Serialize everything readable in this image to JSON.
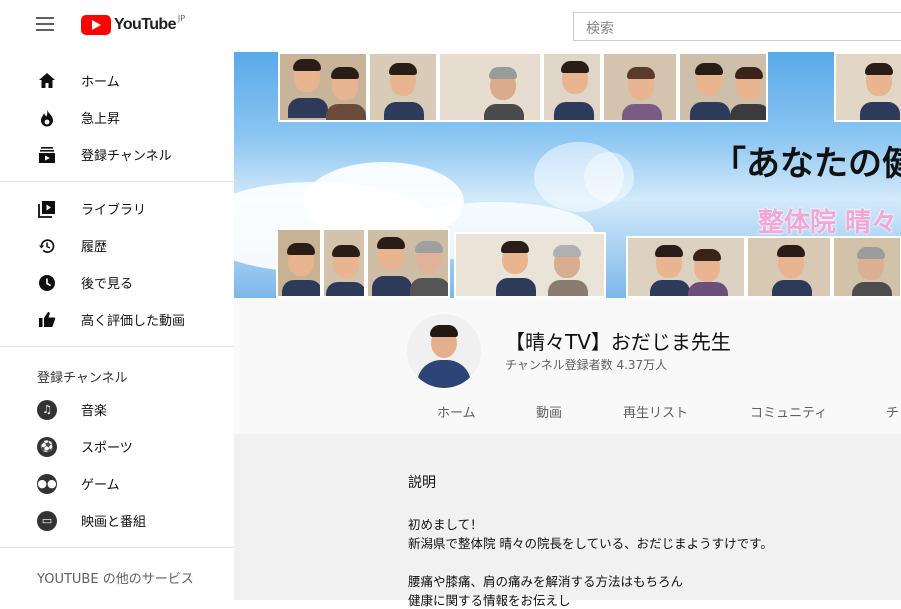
{
  "topbar": {
    "logo_text": "YouTube",
    "logo_region": "JP",
    "search_placeholder": "検索"
  },
  "sidebar": {
    "main": [
      {
        "label": "ホーム",
        "icon": "home-icon"
      },
      {
        "label": "急上昇",
        "icon": "flame-icon"
      },
      {
        "label": "登録チャンネル",
        "icon": "subscriptions-icon"
      }
    ],
    "library": [
      {
        "label": "ライブラリ",
        "icon": "library-icon"
      },
      {
        "label": "履歴",
        "icon": "history-icon"
      },
      {
        "label": "後で見る",
        "icon": "clock-icon"
      },
      {
        "label": "高く評価した動画",
        "icon": "thumbs-up-icon"
      }
    ],
    "subscriptions_heading": "登録チャンネル",
    "subscriptions": [
      {
        "label": "音楽",
        "icon": "music-icon"
      },
      {
        "label": "スポーツ",
        "icon": "sports-icon"
      },
      {
        "label": "ゲーム",
        "icon": "gaming-icon"
      },
      {
        "label": "映画と番組",
        "icon": "movies-icon"
      }
    ],
    "more_heading": "YOUTUBE の他のサービス"
  },
  "banner": {
    "title": "「あなたの健",
    "subtitle": "整体院 晴々"
  },
  "channel": {
    "name": "【晴々TV】おだじま先生",
    "subscribers": "チャンネル登録者数 4.37万人",
    "tabs": [
      "ホーム",
      "動画",
      "再生リスト",
      "コミュニティ",
      "チ"
    ]
  },
  "about": {
    "heading": "説明",
    "lines": [
      "初めまして！",
      "新潟県で整体院 晴々の院長をしている、おだじまようすけです。",
      "",
      "腰痛や膝痛、肩の痛みを解消する方法はもちろん",
      "健康に関する情報をお伝えし"
    ]
  },
  "colors": {
    "brand_red": "#ff0000",
    "banner_sub_pink": "#f3a7d6",
    "avatar_shirt": "#2c4476"
  }
}
